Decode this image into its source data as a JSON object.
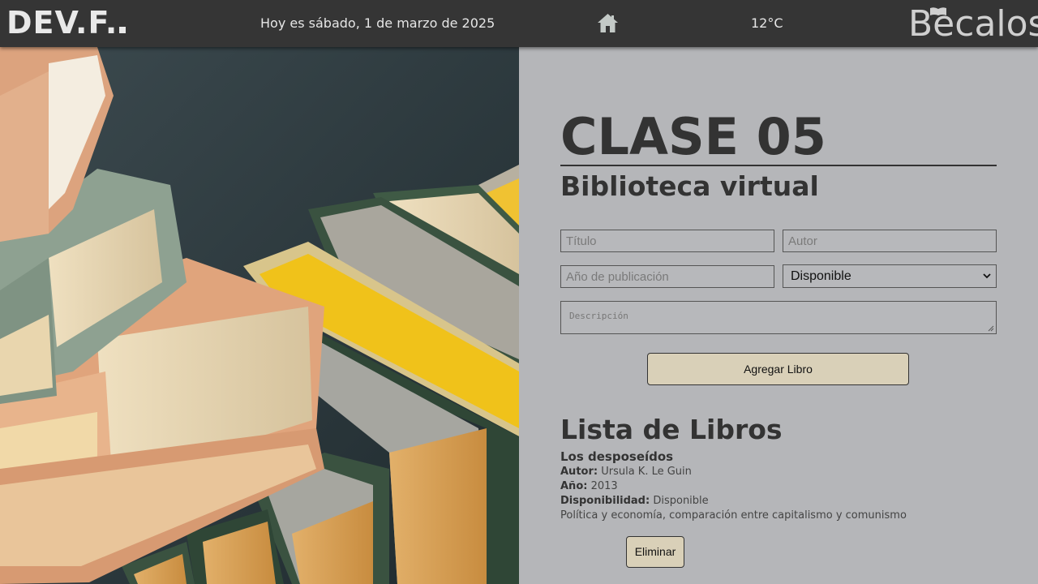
{
  "header": {
    "logo_left": "DEV.F.",
    "date": "Hoy es sábado, 1 de marzo de 2025",
    "temperature": "12°C",
    "logo_right": "Becalos",
    "home_icon": "home-icon",
    "bg_color": "#353535"
  },
  "main": {
    "title": "CLASE 05",
    "subtitle": "Biblioteca virtual",
    "form": {
      "titulo_placeholder": "Título",
      "autor_placeholder": "Autor",
      "anio_placeholder": "Año de publicación",
      "disponibilidad_selected": "Disponible",
      "descripcion_placeholder": "Descripción",
      "add_button": "Agregar Libro"
    },
    "list": {
      "heading": "Lista de Libros",
      "books": [
        {
          "title": "Los desposeídos",
          "autor_label": "Autor:",
          "autor": "Ursula K. Le Guin",
          "anio_label": "Año:",
          "anio": "2013",
          "disp_label": "Disponibilidad:",
          "disp": "Disponible",
          "description": "Política y economía, comparación entre capitalismo y comunismo",
          "delete_button": "Eliminar"
        }
      ]
    }
  },
  "colors": {
    "panel_bg": "#b5b6b9",
    "button_bg": "#d9d0b8",
    "text_dark": "#333333"
  }
}
